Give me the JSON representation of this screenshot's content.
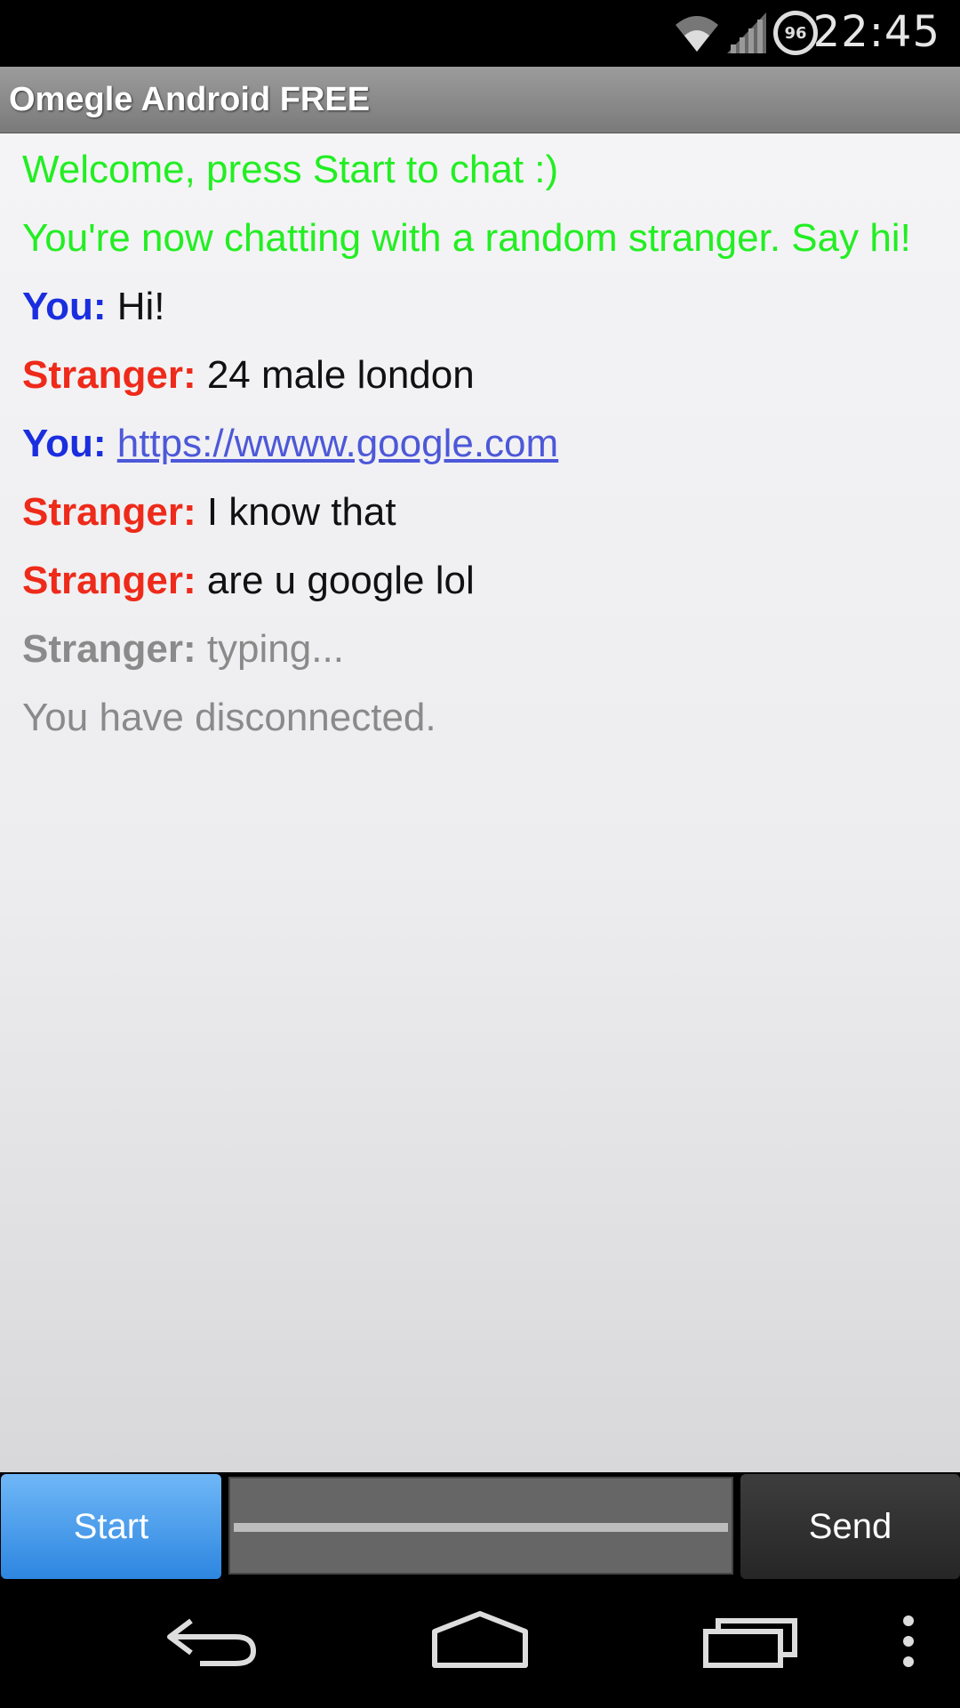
{
  "status_bar": {
    "time": "22:45",
    "battery_level": "96"
  },
  "app": {
    "title": "Omegle Android FREE"
  },
  "chat": {
    "welcome": "Welcome, press Start to chat :)",
    "connected": "You're now chatting with a random stranger. Say hi!",
    "messages": [
      {
        "speaker": "You:",
        "text": "Hi!"
      },
      {
        "speaker": "Stranger:",
        "text": "24 male london"
      },
      {
        "speaker": "You:",
        "text": "https://wwww.google.com"
      },
      {
        "speaker": "Stranger:",
        "text": "I know that"
      },
      {
        "speaker": "Stranger:",
        "text": "are u google lol"
      }
    ],
    "typing": {
      "speaker": "Stranger:",
      "text": "typing..."
    },
    "disconnected": "You have disconnected."
  },
  "controls": {
    "start_label": "Start",
    "send_label": "Send",
    "input_value": ""
  },
  "colors": {
    "system": "#22ee22",
    "you": "#1a2ee0",
    "stranger": "#ee2a1a",
    "start_button": "#2d86e0"
  }
}
